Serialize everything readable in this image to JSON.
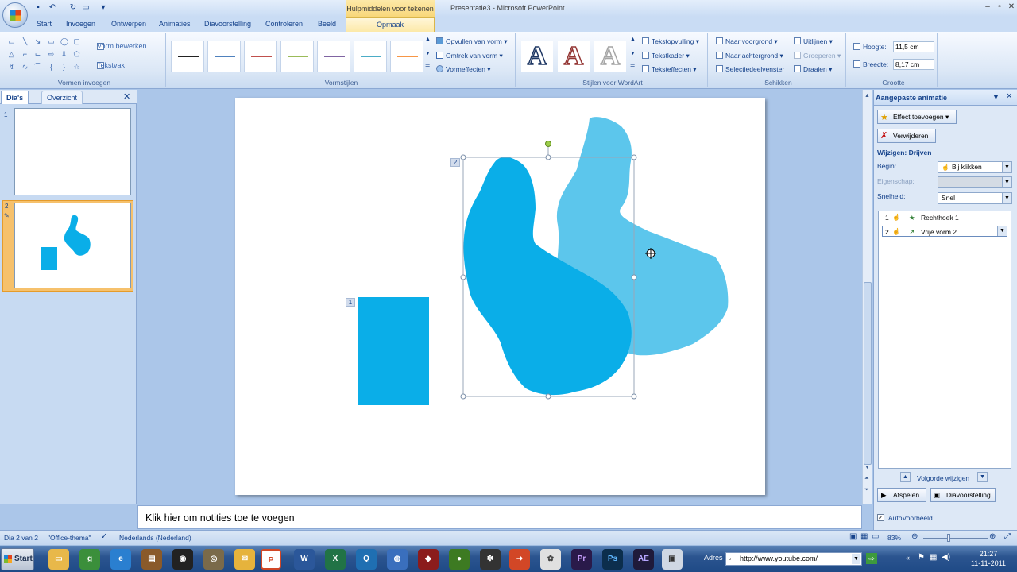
{
  "window": {
    "title": "Presentatie3 - Microsoft PowerPoint",
    "contextual_tools": "Hulpmiddelen voor tekenen"
  },
  "tabs": [
    "Start",
    "Invoegen",
    "Ontwerpen",
    "Animaties",
    "Diavoorstelling",
    "Controleren",
    "Beeld",
    "Opmaak"
  ],
  "ribbon": {
    "group_shapes": "Vormen invoegen",
    "edit_shape": "Vorm bewerken",
    "textbox": "Tekstvak",
    "group_styles": "Vormstijlen",
    "fill": "Opvullen van vorm",
    "outline": "Omtrek van vorm",
    "effects": "Vormeffecten",
    "group_wordart": "Stijlen voor WordArt",
    "text_fill": "Tekstopvulling",
    "text_outline": "Tekstkader",
    "text_effects": "Teksteffecten",
    "group_arrange": "Schikken",
    "bring_front": "Naar voorgrond",
    "send_back": "Naar achtergrond",
    "selection_pane": "Selectiedeelvenster",
    "align": "Uitlijnen",
    "group": "Groeperen",
    "rotate": "Draaien",
    "group_size": "Grootte",
    "height_label": "Hoogte:",
    "height_value": "11,5 cm",
    "width_label": "Breedte:",
    "width_value": "8,17 cm"
  },
  "left_pane": {
    "tab_slides": "Dia's",
    "tab_outline": "Overzicht",
    "slide_numbers": [
      "1",
      "2"
    ]
  },
  "slide": {
    "tag_rect": "1",
    "tag_freeform": "2",
    "shape_color": "#0aaee8",
    "ghost_color": "#5cc6ec"
  },
  "notes_placeholder": "Klik hier om notities toe te voegen",
  "animation_pane": {
    "title": "Aangepaste animatie",
    "add_effect": "Effect toevoegen",
    "remove": "Verwijderen",
    "modify": "Wijzigen: Drijven",
    "start_label": "Begin:",
    "start_value": "Bij klikken",
    "property_label": "Eigenschap:",
    "speed_label": "Snelheid:",
    "speed_value": "Snel",
    "items": [
      {
        "num": "1",
        "name": "Rechthoek 1"
      },
      {
        "num": "2",
        "name": "Vrije vorm 2"
      }
    ],
    "reorder": "Volgorde wijzigen",
    "play": "Afspelen",
    "slideshow": "Diavoorstelling",
    "autopreview": "AutoVoorbeeld"
  },
  "status": {
    "slide_info": "Dia 2 van 2",
    "theme": "\"Office-thema\"",
    "language": "Nederlands (Nederland)",
    "zoom": "83%"
  },
  "taskbar": {
    "start": "Start",
    "address_label": "Adres",
    "address_value": "http://www.youtube.com/",
    "time": "21:27",
    "date": "11-11-2011"
  }
}
